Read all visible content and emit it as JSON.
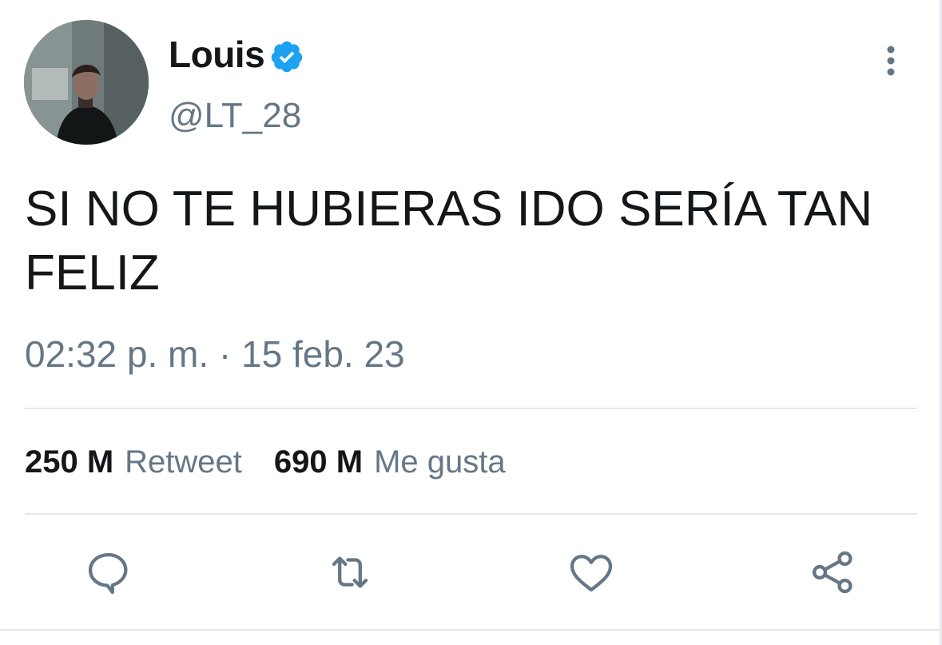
{
  "user": {
    "display_name": "Louis",
    "handle": "@LT_28",
    "verified": true
  },
  "tweet": {
    "text": "SI NO TE HUBIERAS IDO SERÍA TAN FELIZ",
    "timestamp": "02:32 p. m. · 15 feb. 23"
  },
  "stats": {
    "retweets_count": "250 M",
    "retweets_label": "Retweet",
    "likes_count": "690 M",
    "likes_label": "Me gusta"
  },
  "actions": {
    "reply_icon": "reply-icon",
    "retweet_icon": "retweet-icon",
    "like_icon": "heart-icon",
    "share_icon": "share-icon"
  },
  "colors": {
    "verified_blue": "#1da1f2",
    "muted_text": "#657786",
    "primary_text": "#14171a",
    "divider": "#e1e8ed"
  }
}
